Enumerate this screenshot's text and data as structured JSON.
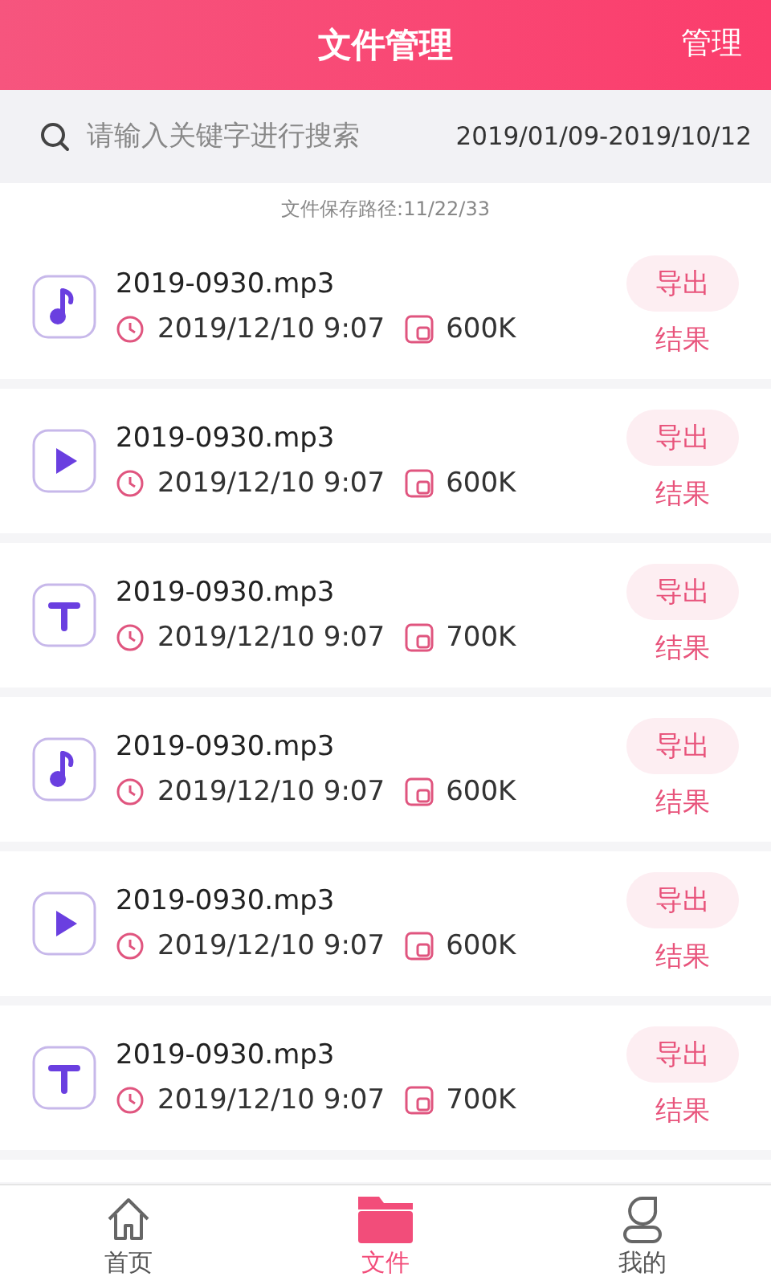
{
  "header": {
    "title": "文件管理",
    "action": "管理"
  },
  "search": {
    "placeholder": "请输入关键字进行搜索",
    "date_range": "2019/01/09-2019/10/12"
  },
  "save_path": "文件保存路径:11/22/33",
  "files": [
    {
      "kind": "music",
      "name": "2019-0930.mp3",
      "time": "2019/12/10 9:07",
      "size": "600K",
      "export": "导出",
      "result": "结果"
    },
    {
      "kind": "video",
      "name": "2019-0930.mp3",
      "time": "2019/12/10 9:07",
      "size": "600K",
      "export": "导出",
      "result": "结果"
    },
    {
      "kind": "text",
      "name": "2019-0930.mp3",
      "time": "2019/12/10 9:07",
      "size": "700K",
      "export": "导出",
      "result": "结果"
    },
    {
      "kind": "music",
      "name": "2019-0930.mp3",
      "time": "2019/12/10 9:07",
      "size": "600K",
      "export": "导出",
      "result": "结果"
    },
    {
      "kind": "video",
      "name": "2019-0930.mp3",
      "time": "2019/12/10 9:07",
      "size": "600K",
      "export": "导出",
      "result": "结果"
    },
    {
      "kind": "text",
      "name": "2019-0930.mp3",
      "time": "2019/12/10 9:07",
      "size": "700K",
      "export": "导出",
      "result": "结果"
    }
  ],
  "tabs": [
    {
      "kind": "home",
      "label": "首页",
      "selected": false
    },
    {
      "kind": "files",
      "label": "文件",
      "selected": true
    },
    {
      "kind": "profile",
      "label": "我的",
      "selected": false
    }
  ]
}
